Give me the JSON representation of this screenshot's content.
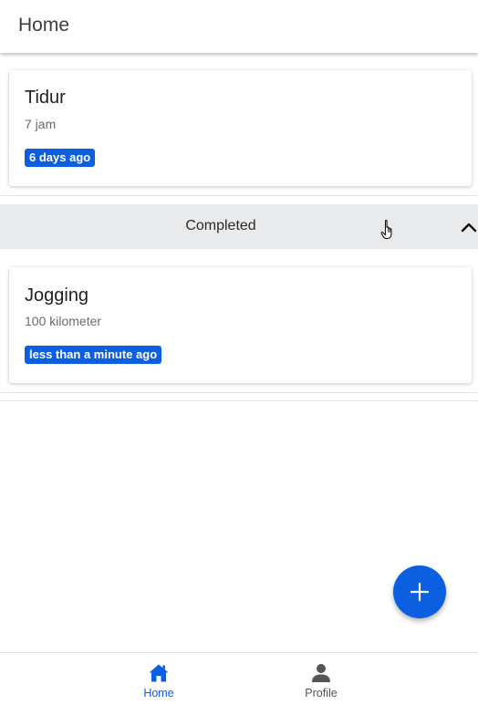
{
  "header": {
    "title": "Home"
  },
  "tasks": [
    {
      "title": "Tidur",
      "detail": "7 jam",
      "time_badge": "6 days ago"
    }
  ],
  "completed_section": {
    "label": "Completed",
    "expanded": true
  },
  "completed_tasks": [
    {
      "title": "Jogging",
      "detail": "100 kilometer",
      "time_badge": "less than a minute ago"
    }
  ],
  "fab": {
    "icon": "plus-icon"
  },
  "bottom_nav": {
    "items": [
      {
        "label": "Home",
        "icon": "home-icon",
        "active": true
      },
      {
        "label": "Profile",
        "icon": "person-icon",
        "active": false
      }
    ]
  },
  "colors": {
    "accent": "#0b5fe0",
    "section_bg": "#e9eaec",
    "inactive_nav": "#555555"
  }
}
